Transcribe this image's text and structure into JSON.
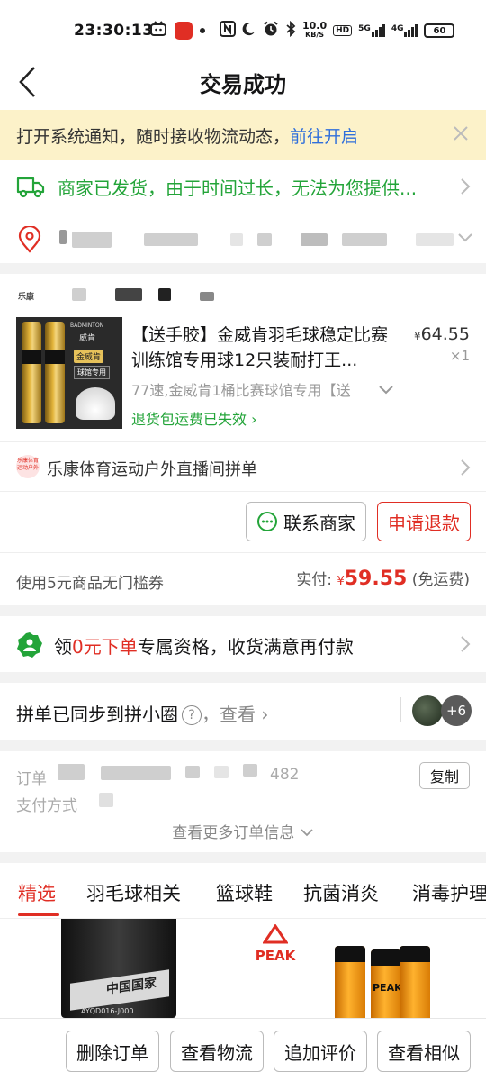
{
  "status_bar": {
    "time": "23:30:13",
    "network_speed": "10.0",
    "network_speed_unit": "KB/S",
    "hd_badge": "HD",
    "signal_1": "5G",
    "signal_2": "4G",
    "battery": "60"
  },
  "nav": {
    "title": "交易成功"
  },
  "notice": {
    "text": "打开系统通知，随时接收物流动态，",
    "link": "前往开启"
  },
  "shipping": {
    "text": "商家已发货，由于时间过长，无法为您提供..."
  },
  "shop": {
    "logo_text": "乐康"
  },
  "product": {
    "title": "【送手胶】金威肯羽毛球稳定比赛训练馆专用球12只装耐打王...",
    "currency": "¥",
    "price": "64.55",
    "quantity": "×1",
    "sku": "77速,金威肯1桶比赛球馆专用【送",
    "return_info": "退货包运费已失效",
    "image_text": {
      "brand": "BADMINTON",
      "name": "威肯",
      "label": "金威肯",
      "tag": "球馆专用"
    }
  },
  "group": {
    "icon_text": "乐康体育运动户外",
    "text": "乐康体育运动户外直播间拼单"
  },
  "actions": {
    "contact": "联系商家",
    "refund": "申请退款"
  },
  "payment": {
    "coupon": "使用5元商品无门槛券",
    "paid_label": "实付:",
    "currency": "¥",
    "amount": "59.55",
    "shipping_note": "(免运费)"
  },
  "promo": {
    "prefix": "领",
    "highlight": "0元下单",
    "suffix": "专属资格，收货满意再付款"
  },
  "circle": {
    "text": "拼单已同步到拼小圈",
    "help": "?",
    "view": "，查看",
    "extra_count": "+6"
  },
  "order_info": {
    "label_1": "订单",
    "label_1_tail": "482",
    "label_2": "支付方式",
    "copy": "复制",
    "more": "查看更多订单信息"
  },
  "tabs": [
    "精选",
    "羽毛球相关",
    "篮球鞋",
    "抗菌消炎",
    "消毒护理"
  ],
  "feed": {
    "left_text": "中国国家",
    "left_code": "AYQD016-J000",
    "right_brand": "PEAK",
    "right_tube_text": "PEAK"
  },
  "bottom_buttons": [
    "删除订单",
    "查看物流",
    "追加评价",
    "查看相似"
  ],
  "colors": {
    "accent_red": "#e02e24",
    "success_green": "#23a439",
    "link_blue": "#2f6fdb",
    "notice_bg": "#fcf2c9"
  }
}
